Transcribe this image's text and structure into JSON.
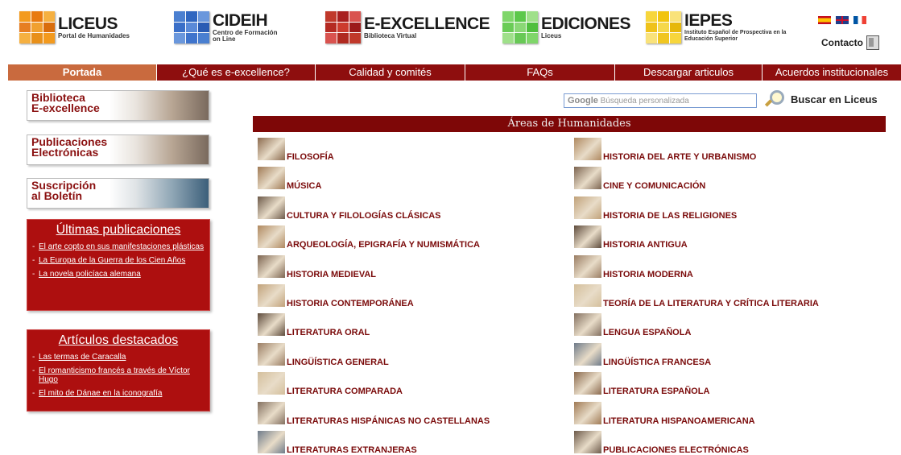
{
  "header": {
    "logos": [
      {
        "title": "LICEUS",
        "subtitle": "Portal de Humanidades"
      },
      {
        "title": "CIDEIH",
        "subtitle": "Centro de Formación on Line"
      },
      {
        "title": "E-EXCELLENCE",
        "subtitle": "Biblioteca Virtual"
      },
      {
        "title": "EDICIONES",
        "subtitle": "Liceus"
      },
      {
        "title": "IEPES",
        "subtitle": "Instituto Español de Prospectiva en la Educación Superior"
      }
    ],
    "contact_label": "Contacto"
  },
  "nav": {
    "items": [
      "Portada",
      "¿Qué es e-excellence?",
      "Calidad y comités",
      "FAQs",
      "Descargar articulos",
      "Acuerdos institucionales"
    ]
  },
  "sidebar": {
    "banners": [
      {
        "label": "Biblioteca\nE-excellence"
      },
      {
        "label": "Publicaciones\nElectrónicas"
      },
      {
        "label": "Suscripción\nal Boletín"
      }
    ],
    "latest": {
      "title": "Últimas publicaciones",
      "items": [
        "El arte copto en sus manifestaciones plásticas",
        "La Europa de la Guerra de los Cien Años",
        "La novela policíaca alemana"
      ]
    },
    "featured": {
      "title": "Artículos destacados",
      "items": [
        "Las termas de Caracalla",
        "El romanticismo francés a través de Víctor Hugo",
        "El mito de Dánae en la iconografía"
      ]
    }
  },
  "search": {
    "placeholder": "Búsqueda personalizada",
    "google_label": "Google",
    "button_label": "Buscar en Liceus"
  },
  "areas": {
    "title": "Áreas de Humanidades",
    "left": [
      "FILOSOFÍA",
      "MÚSICA",
      "CULTURA Y FILOLOGÍAS CLÁSICAS",
      "ARQUEOLOGÍA, EPIGRAFÍA Y NUMISMÁTICA",
      "HISTORIA MEDIEVAL",
      "HISTORIA CONTEMPORÁNEA",
      "LITERATURA ORAL",
      "LINGÜÍSTICA GENERAL",
      "LITERATURA COMPARADA",
      "LITERATURAS HISPÁNICAS NO CASTELLANAS",
      "LITERATURAS EXTRANJERAS"
    ],
    "right": [
      "HISTORIA DEL ARTE Y URBANISMO",
      "CINE Y COMUNICACIÓN",
      "HISTORIA DE LAS RELIGIONES",
      "HISTORIA ANTIGUA",
      "HISTORIA MODERNA",
      "TEORÍA DE LA LITERATURA Y CRÍTICA LITERARIA",
      "LENGUA ESPAÑOLA",
      "LINGÜÍSTICA FRANCESA",
      "LITERATURA ESPAÑOLA",
      "LITERATURA HISPANOAMERICANA",
      "PUBLICACIONES ELECTRÓNICAS"
    ]
  }
}
